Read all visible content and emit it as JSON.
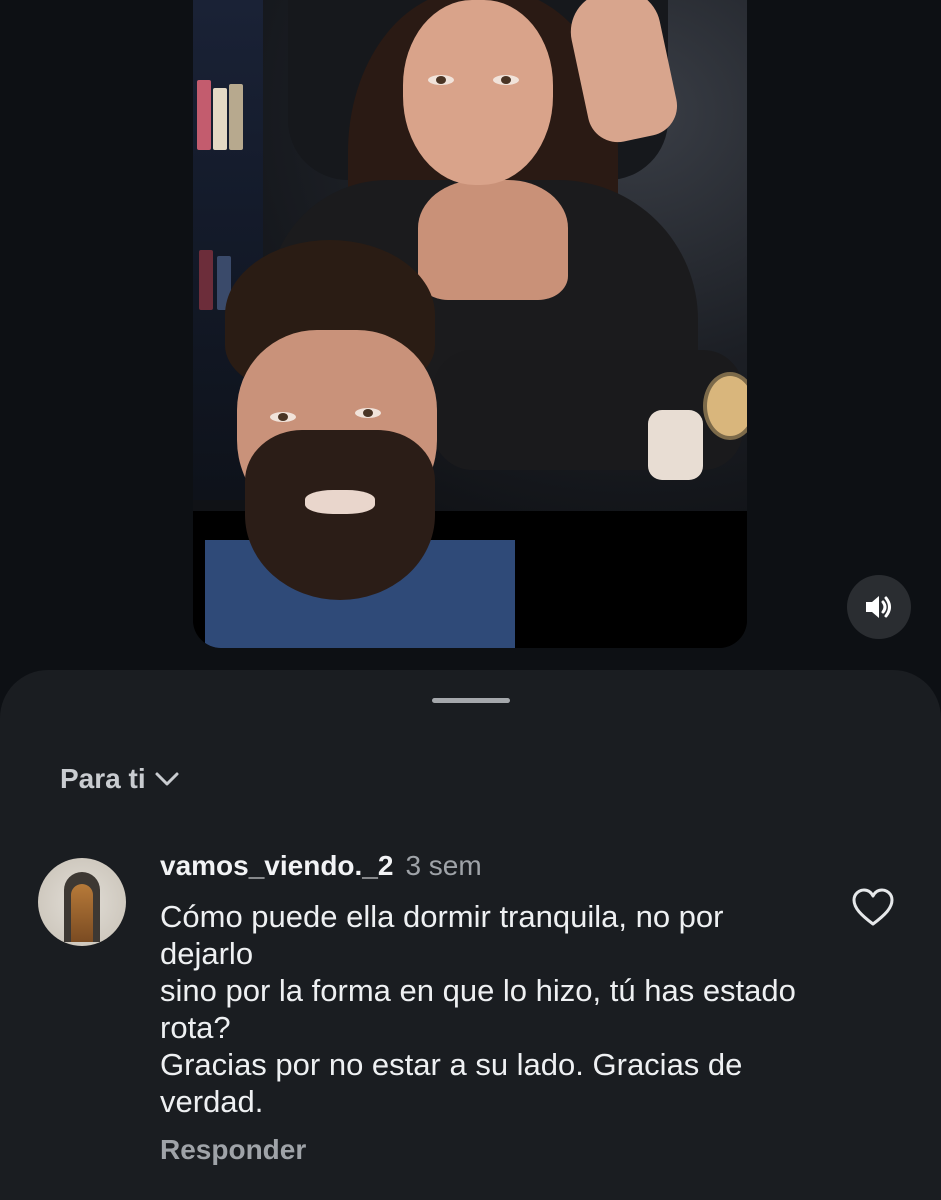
{
  "video": {
    "sound_icon": "speaker-volume-icon"
  },
  "comments_sheet": {
    "filter_label": "Para ti",
    "filter_icon": "chevron-down-icon",
    "comment": {
      "username": "vamos_viendo._2",
      "timestamp": "3 sem",
      "text": "Cómo puede ella dormir tranquila, no por dejarlo\nsino por la forma en que lo hizo, tú has estado rota?\nGracias por no estar a su lado. Gracias de verdad.",
      "reply_label": "Responder",
      "like_icon": "heart-outline-icon"
    }
  },
  "colors": {
    "background": "#0d1014",
    "sheet": "#1a1d21",
    "primary_text": "#eef0f2",
    "secondary_text": "#9fa3a8"
  }
}
